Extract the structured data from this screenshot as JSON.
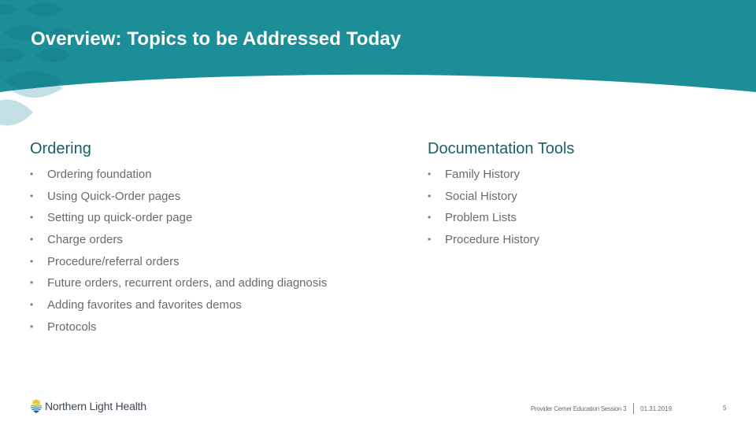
{
  "slide": {
    "title": "Overview: Topics to be Addressed Today",
    "colors": {
      "banner": "#1b8e98",
      "banner_leaf": "#147c86",
      "light_leaf": "#c4dfe3",
      "heading": "#1a5e66",
      "body_text": "#6b6b6b"
    }
  },
  "left_column": {
    "heading": "Ordering",
    "bullet_symbol": "•",
    "items": [
      "Ordering foundation",
      "Using Quick-Order pages",
      "Setting up quick-order page",
      "Charge orders",
      "Procedure/referral orders",
      "Future orders, recurrent orders, and adding diagnosis",
      "Adding favorites and favorites demos",
      "Protocols"
    ]
  },
  "right_column": {
    "heading": "Documentation Tools",
    "bullet_symbol": "•",
    "items": [
      "Family History",
      "Social History",
      "Problem Lists",
      "Procedure History"
    ]
  },
  "logo": {
    "icon": "sunrise-water-logo-icon",
    "text": "Northern Light Health",
    "suffix": "."
  },
  "footer": {
    "session": "Provider Cerner Education Session 3",
    "separator": "|",
    "date": "01.31.2019",
    "page_number": "5"
  }
}
